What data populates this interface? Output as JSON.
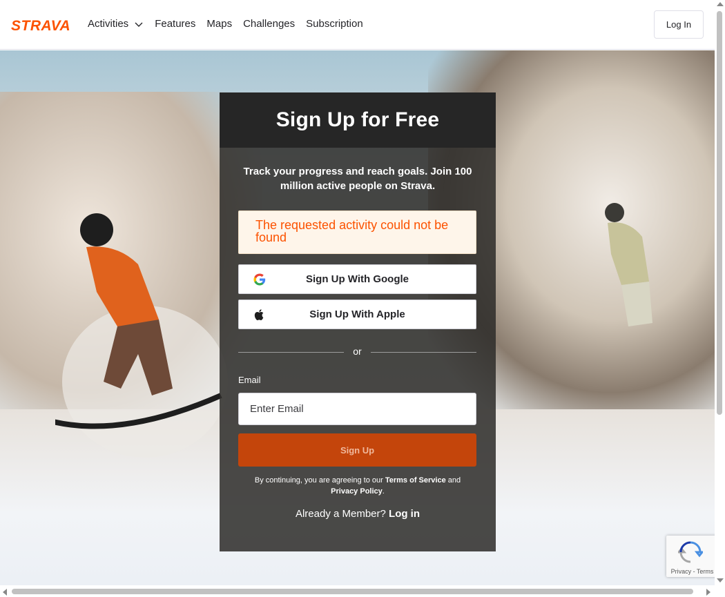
{
  "header": {
    "logo_text": "STRAVA",
    "nav": [
      {
        "label": "Activities",
        "has_dropdown": true
      },
      {
        "label": "Features"
      },
      {
        "label": "Maps"
      },
      {
        "label": "Challenges"
      },
      {
        "label": "Subscription"
      }
    ],
    "login_label": "Log In"
  },
  "signup": {
    "title": "Sign Up for Free",
    "tagline": "Track your progress and reach goals. Join 100 million active people on Strava.",
    "alert": "The requested activity could not be found",
    "google_label": "Sign Up With Google",
    "apple_label": "Sign Up With Apple",
    "divider_text": "or",
    "email_label": "Email",
    "email_placeholder": "Enter Email",
    "email_value": "",
    "submit_label": "Sign Up",
    "terms_prefix": "By continuing, you are agreeing to our",
    "terms_link": "Terms of Service",
    "terms_and": "and",
    "privacy_link": "Privacy Policy",
    "privacy_suffix": ".",
    "member_text": "Already a Member?",
    "member_link": "Log in"
  },
  "recaptcha": {
    "links": "Privacy - Terms"
  },
  "colors": {
    "brand": "#fc5200",
    "submit_bg": "#c4450b",
    "card_bg": "#2d2c2a"
  },
  "icons": [
    "strava-logo",
    "chevron-down-icon",
    "google-icon",
    "apple-icon",
    "recaptcha-icon"
  ]
}
